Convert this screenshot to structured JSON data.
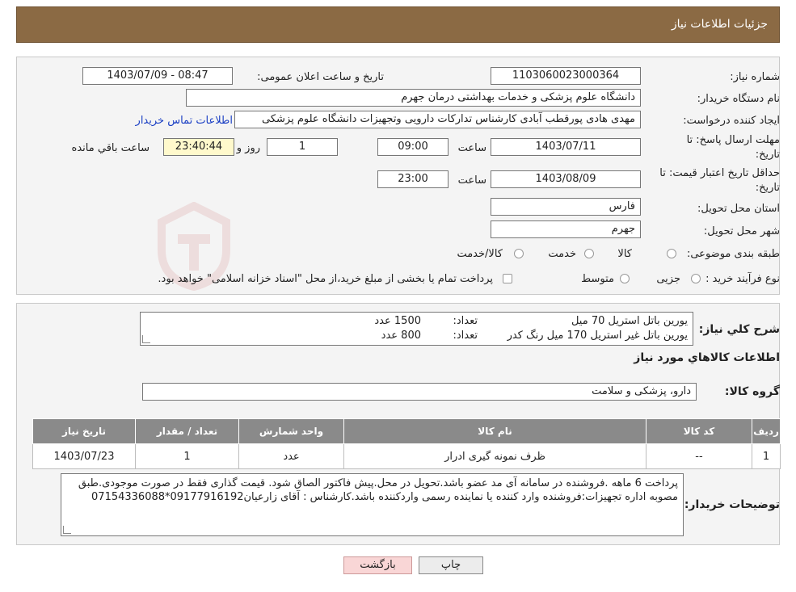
{
  "header": {
    "title": "جزئیات اطلاعات نیاز"
  },
  "form": {
    "need_number_label": "شماره نیاز:",
    "need_number": "1103060023000364",
    "announce_label": "تاریخ و ساعت اعلان عمومی:",
    "announce_value": "1403/07/09 - 08:47",
    "buyer_org_label": "نام دستگاه خریدار:",
    "buyer_org": "دانشگاه علوم پزشکی و خدمات بهداشتی  درمان جهرم",
    "creator_label": "ایجاد کننده درخواست:",
    "creator": "مهدی هادی پورقطب آبادی کارشناس تدارکات دارویی وتجهیزات دانشگاه علوم پزشکی",
    "contact_link": "اطلاعات تماس خریدار",
    "deadline_label_1": "مهلت ارسال پاسخ: تا",
    "deadline_label_2": "تاریخ:",
    "deadline_date": "1403/07/11",
    "time_label": "ساعت",
    "deadline_time": "09:00",
    "days_value": "1",
    "days_label": "روز و",
    "remaining_time": "23:40:44",
    "remaining_label": "ساعت باقي مانده",
    "validity_label_1": "حداقل تاریخ اعتبار قیمت: تا",
    "validity_label_2": "تاریخ:",
    "validity_date": "1403/08/09",
    "validity_time_label": "ساعت",
    "validity_time": "23:00",
    "province_label": "استان محل تحویل:",
    "province": "فارس",
    "city_label": "شهر محل تحویل:",
    "city": "جهرم",
    "category_label": "طبقه بندی موضوعی:",
    "category_options": [
      "کالا",
      "خدمت",
      "کالا/خدمت"
    ],
    "process_label": "نوع فرآیند خرید :",
    "process_options": [
      "جزیی",
      "متوسط"
    ],
    "process_note": "پرداخت تمام یا بخشی از مبلغ خرید،از محل \"اسناد خزانه اسلامی\" خواهد بود."
  },
  "need": {
    "summary_label": "شرح کلي نياز:",
    "lines": [
      {
        "item": "یورین باتل استریل  70 میل",
        "qty_label": "تعداد:",
        "qty": "1500 عدد"
      },
      {
        "item": "یورین باتل غیر استریل  170 میل رنگ کدر",
        "qty_label": "تعداد:",
        "qty": "800  عدد"
      }
    ],
    "goods_info_title": "اطلاعات کالاهاي مورد نياز",
    "group_label": "گروه کالا:",
    "group_value": "دارو، پزشکی و سلامت"
  },
  "table": {
    "headers": [
      "رديف",
      "کد کالا",
      "نام کالا",
      "واحد شمارش",
      "تعداد / مقدار",
      "تاریخ نیاز"
    ],
    "rows": [
      [
        "1",
        "--",
        "ظرف نمونه گیری ادرار",
        "عدد",
        "1",
        "1403/07/23"
      ]
    ]
  },
  "buyer_notes": {
    "label": "توضیحات خریدار:",
    "text": "پرداخت 6 ماهه .فروشنده در سامانه آی مد عضو باشد.تحویل در محل.پیش فاکتور الصاق شود. قیمت گذاری فقط در صورت موجودی.طبق مصوبه اداره تجهیزات:فروشنده وارد کننده یا نماینده رسمی واردکننده باشد.کارشناس : آقای زارعیان09177916192*07154336088"
  },
  "buttons": {
    "print": "چاپ",
    "back": "بازگشت"
  },
  "colors": {
    "header_bg": "#8b6a44",
    "table_header_bg": "#8a8a8a",
    "link": "#1a3fc4"
  }
}
